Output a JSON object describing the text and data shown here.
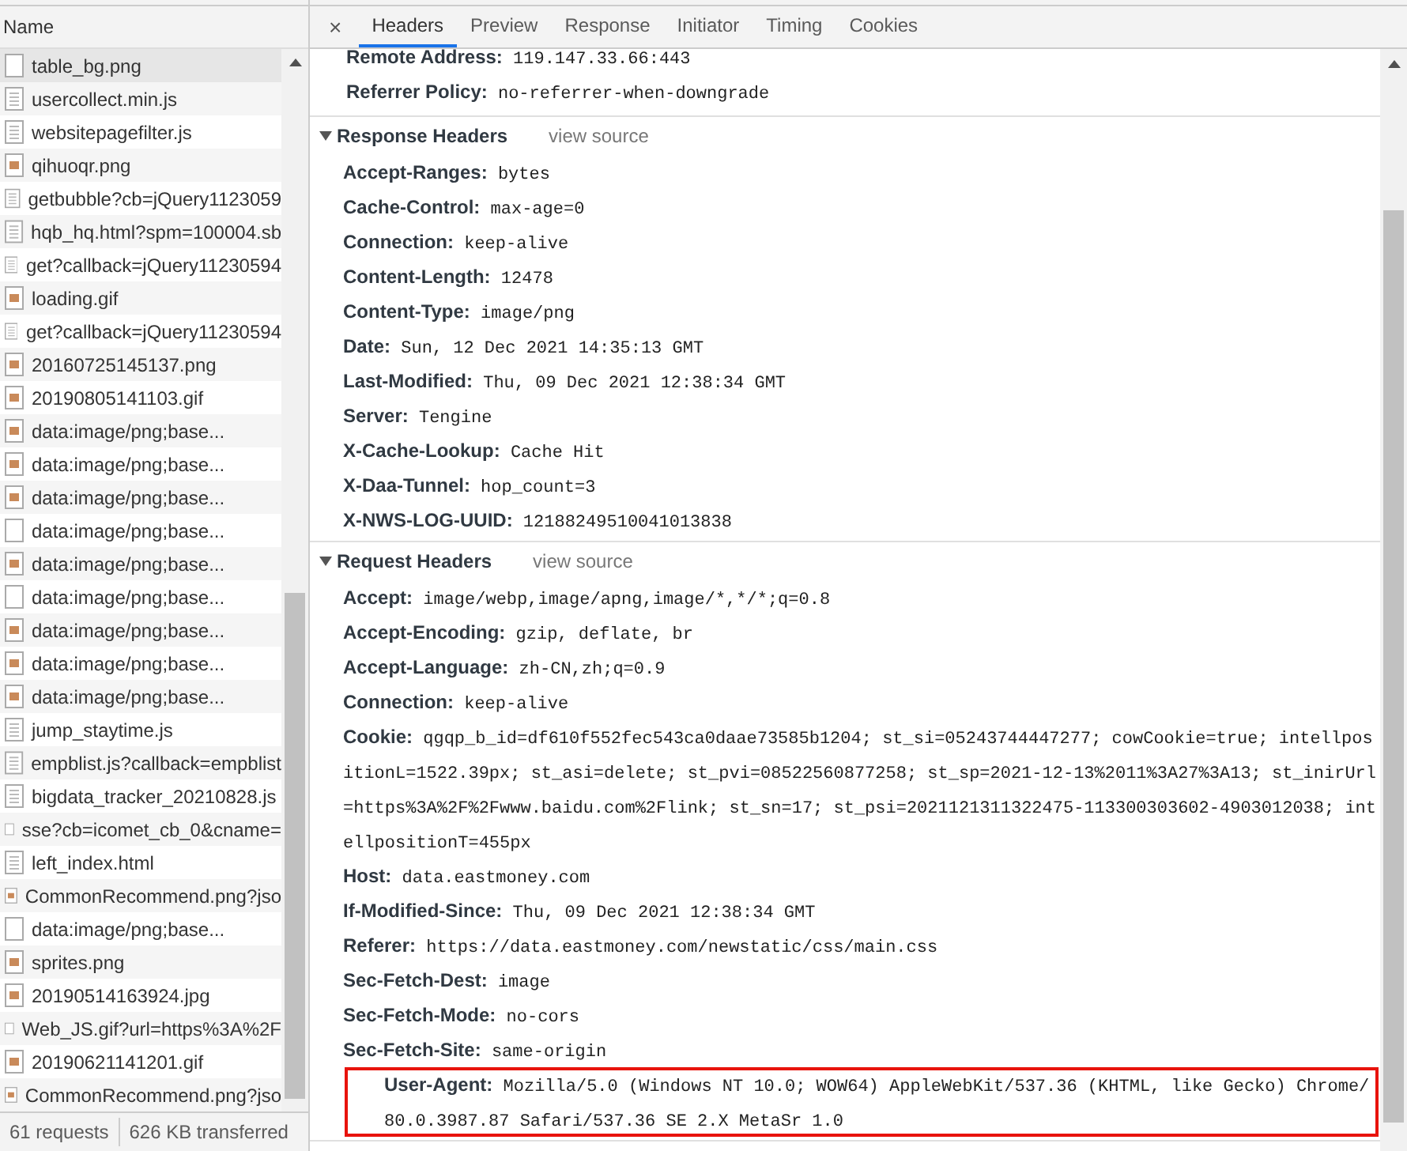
{
  "requests": {
    "column_heading": "Name",
    "rows": [
      {
        "name": "table_bg.png",
        "kind": "file",
        "selected": true
      },
      {
        "name": "usercollect.min.js",
        "kind": "script",
        "selected": false
      },
      {
        "name": "websitepagefilter.js",
        "kind": "script",
        "selected": false
      },
      {
        "name": "qihuoqr.png",
        "kind": "image",
        "selected": false
      },
      {
        "name": "getbubble?cb=jQuery1123059",
        "kind": "script",
        "selected": false
      },
      {
        "name": "hqb_hq.html?spm=100004.sb",
        "kind": "script",
        "selected": false
      },
      {
        "name": "get?callback=jQuery11230594",
        "kind": "script",
        "selected": false
      },
      {
        "name": "loading.gif",
        "kind": "image",
        "selected": false
      },
      {
        "name": "get?callback=jQuery11230594",
        "kind": "script",
        "selected": false
      },
      {
        "name": "20160725145137.png",
        "kind": "image",
        "selected": false
      },
      {
        "name": "20190805141103.gif",
        "kind": "image",
        "selected": false
      },
      {
        "name": "data:image/png;base...",
        "kind": "image",
        "selected": false
      },
      {
        "name": "data:image/png;base...",
        "kind": "image",
        "selected": false
      },
      {
        "name": "data:image/png;base...",
        "kind": "image",
        "selected": false
      },
      {
        "name": "data:image/png;base...",
        "kind": "file",
        "selected": false
      },
      {
        "name": "data:image/png;base...",
        "kind": "image",
        "selected": false
      },
      {
        "name": "data:image/png;base...",
        "kind": "file",
        "selected": false
      },
      {
        "name": "data:image/png;base...",
        "kind": "image",
        "selected": false
      },
      {
        "name": "data:image/png;base...",
        "kind": "image",
        "selected": false
      },
      {
        "name": "data:image/png;base...",
        "kind": "image",
        "selected": false
      },
      {
        "name": "jump_staytime.js",
        "kind": "script",
        "selected": false
      },
      {
        "name": "empblist.js?callback=empblist",
        "kind": "script",
        "selected": false
      },
      {
        "name": "bigdata_tracker_20210828.js",
        "kind": "script",
        "selected": false
      },
      {
        "name": "sse?cb=icomet_cb_0&cname=",
        "kind": "file",
        "selected": false
      },
      {
        "name": "left_index.html",
        "kind": "script",
        "selected": false
      },
      {
        "name": "CommonRecommend.png?jso",
        "kind": "image",
        "selected": false
      },
      {
        "name": "data:image/png;base...",
        "kind": "file",
        "selected": false
      },
      {
        "name": "sprites.png",
        "kind": "image",
        "selected": false
      },
      {
        "name": "20190514163924.jpg",
        "kind": "image",
        "selected": false
      },
      {
        "name": "Web_JS.gif?url=https%3A%2F",
        "kind": "file",
        "selected": false
      },
      {
        "name": "20190621141201.gif",
        "kind": "image",
        "selected": false
      },
      {
        "name": "CommonRecommend.png?jso",
        "kind": "image",
        "selected": false
      }
    ],
    "status_bar": [
      "61 requests",
      "626 KB transferred"
    ]
  },
  "tabs": [
    {
      "label": "Headers",
      "selected": true
    },
    {
      "label": "Preview",
      "selected": false
    },
    {
      "label": "Response",
      "selected": false
    },
    {
      "label": "Initiator",
      "selected": false
    },
    {
      "label": "Timing",
      "selected": false
    },
    {
      "label": "Cookies",
      "selected": false
    }
  ],
  "close_symbol": "×",
  "general": [
    {
      "key": "Remote Address:",
      "value": "119.147.33.66:443"
    },
    {
      "key": "Referrer Policy:",
      "value": "no-referrer-when-downgrade"
    }
  ],
  "sections": [
    {
      "title": "Response Headers",
      "link": "view source",
      "expanded": true,
      "headers": [
        {
          "key": "Accept-Ranges:",
          "value": "bytes",
          "highlighted": false
        },
        {
          "key": "Cache-Control:",
          "value": "max-age=0",
          "highlighted": false
        },
        {
          "key": "Connection:",
          "value": "keep-alive",
          "highlighted": false
        },
        {
          "key": "Content-Length:",
          "value": "12478",
          "highlighted": false
        },
        {
          "key": "Content-Type:",
          "value": "image/png",
          "highlighted": false
        },
        {
          "key": "Date:",
          "value": "Sun, 12 Dec 2021 14:35:13 GMT",
          "highlighted": false
        },
        {
          "key": "Last-Modified:",
          "value": "Thu, 09 Dec 2021 12:38:34 GMT",
          "highlighted": false
        },
        {
          "key": "Server:",
          "value": "Tengine",
          "highlighted": false
        },
        {
          "key": "X-Cache-Lookup:",
          "value": "Cache Hit",
          "highlighted": false
        },
        {
          "key": "X-Daa-Tunnel:",
          "value": "hop_count=3",
          "highlighted": false
        },
        {
          "key": "X-NWS-LOG-UUID:",
          "value": "12188249510041013838",
          "highlighted": false
        }
      ]
    },
    {
      "title": "Request Headers",
      "link": "view source",
      "expanded": true,
      "headers": [
        {
          "key": "Accept:",
          "value": "image/webp,image/apng,image/*,*/*;q=0.8",
          "highlighted": false
        },
        {
          "key": "Accept-Encoding:",
          "value": "gzip, deflate, br",
          "highlighted": false
        },
        {
          "key": "Accept-Language:",
          "value": "zh-CN,zh;q=0.9",
          "highlighted": false
        },
        {
          "key": "Connection:",
          "value": "keep-alive",
          "highlighted": false
        },
        {
          "key": "Cookie:",
          "value": "qgqp_b_id=df610f552fec543ca0daae73585b1204; st_si=05243744447277; cowCookie=true; intellpositionL=1522.39px; st_asi=delete; st_pvi=08522560877258; st_sp=2021-12-13%2011%3A27%3A13; st_inirUrl=https%3A%2F%2Fwww.baidu.com%2Flink; st_sn=17; st_psi=2021121311322475-113300303602-4903012038; intellpositionT=455px",
          "highlighted": false
        },
        {
          "key": "Host:",
          "value": "data.eastmoney.com",
          "highlighted": false
        },
        {
          "key": "If-Modified-Since:",
          "value": "Thu, 09 Dec 2021 12:38:34 GMT",
          "highlighted": false
        },
        {
          "key": "Referer:",
          "value": "https://data.eastmoney.com/newstatic/css/main.css",
          "highlighted": false
        },
        {
          "key": "Sec-Fetch-Dest:",
          "value": "image",
          "highlighted": false
        },
        {
          "key": "Sec-Fetch-Mode:",
          "value": "no-cors",
          "highlighted": false
        },
        {
          "key": "Sec-Fetch-Site:",
          "value": "same-origin",
          "highlighted": false
        },
        {
          "key": "User-Agent:",
          "value": "Mozilla/5.0 (Windows NT 10.0; WOW64) AppleWebKit/537.36 (KHTML, like Gecko) Chrome/80.0.3987.87 Safari/537.36 SE 2.X MetaSr 1.0",
          "highlighted": true
        }
      ]
    }
  ]
}
